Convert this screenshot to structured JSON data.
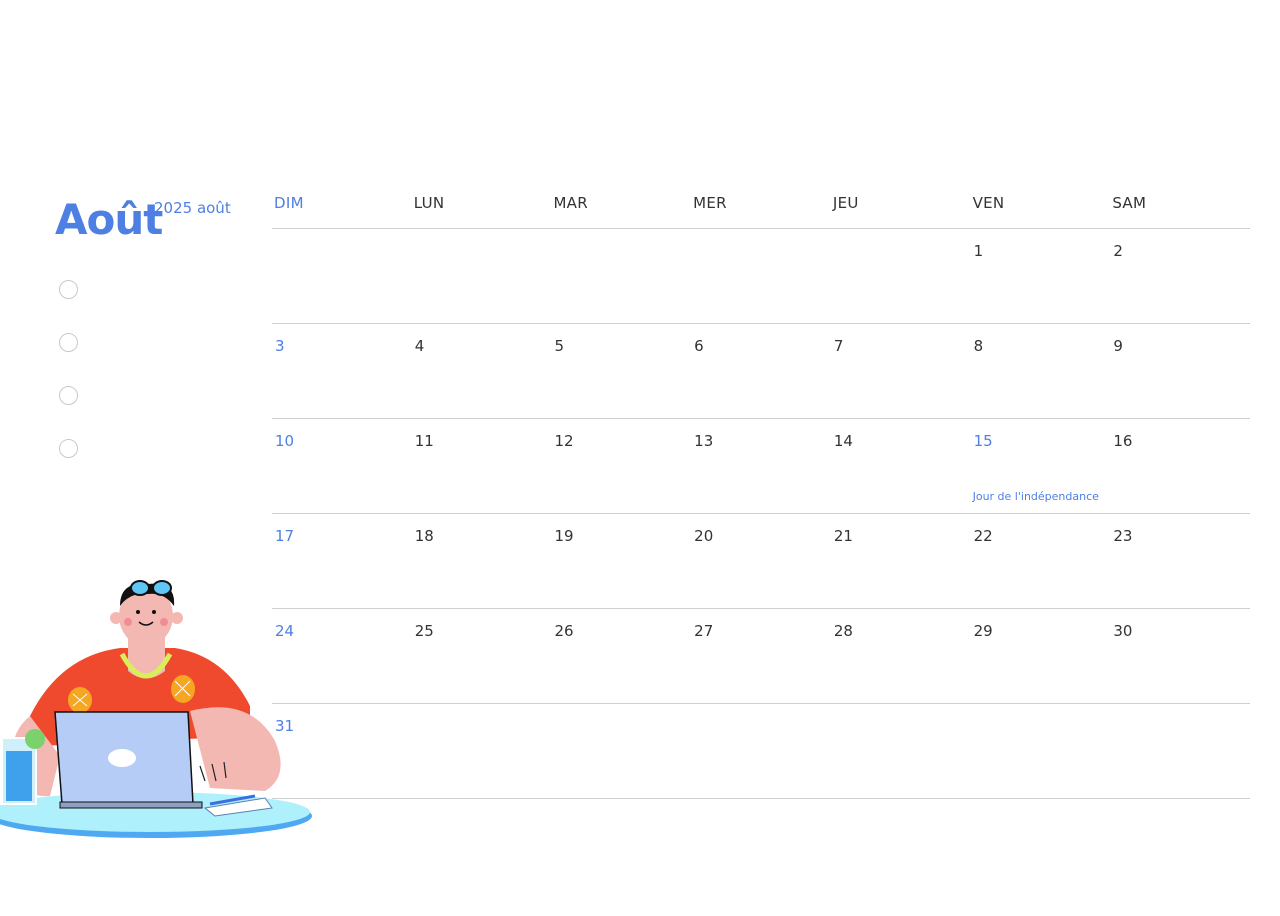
{
  "header": {
    "month": "Août",
    "year_label": "2025 août"
  },
  "checklist": {
    "count": 4
  },
  "calendar": {
    "weekdays": [
      "DIM",
      "LUN",
      "MAR",
      "MER",
      "JEU",
      "VEN",
      "SAM"
    ],
    "weeks": [
      [
        "",
        "",
        "",
        "",
        "",
        "1",
        "2"
      ],
      [
        "3",
        "4",
        "5",
        "6",
        "7",
        "8",
        "9"
      ],
      [
        "10",
        "11",
        "12",
        "13",
        "14",
        "15",
        "16"
      ],
      [
        "17",
        "18",
        "19",
        "20",
        "21",
        "22",
        "23"
      ],
      [
        "24",
        "25",
        "26",
        "27",
        "28",
        "29",
        "30"
      ],
      [
        "31",
        "",
        "",
        "",
        "",
        "",
        ""
      ]
    ],
    "holidays": [
      {
        "day": "15",
        "label": "Jour de l'indépendance"
      }
    ]
  },
  "colors": {
    "accent": "#4e7fe3",
    "grid_line": "#cfcfcf",
    "text": "#333333"
  },
  "illustration": {
    "icon": "person-with-laptop-illustration"
  }
}
